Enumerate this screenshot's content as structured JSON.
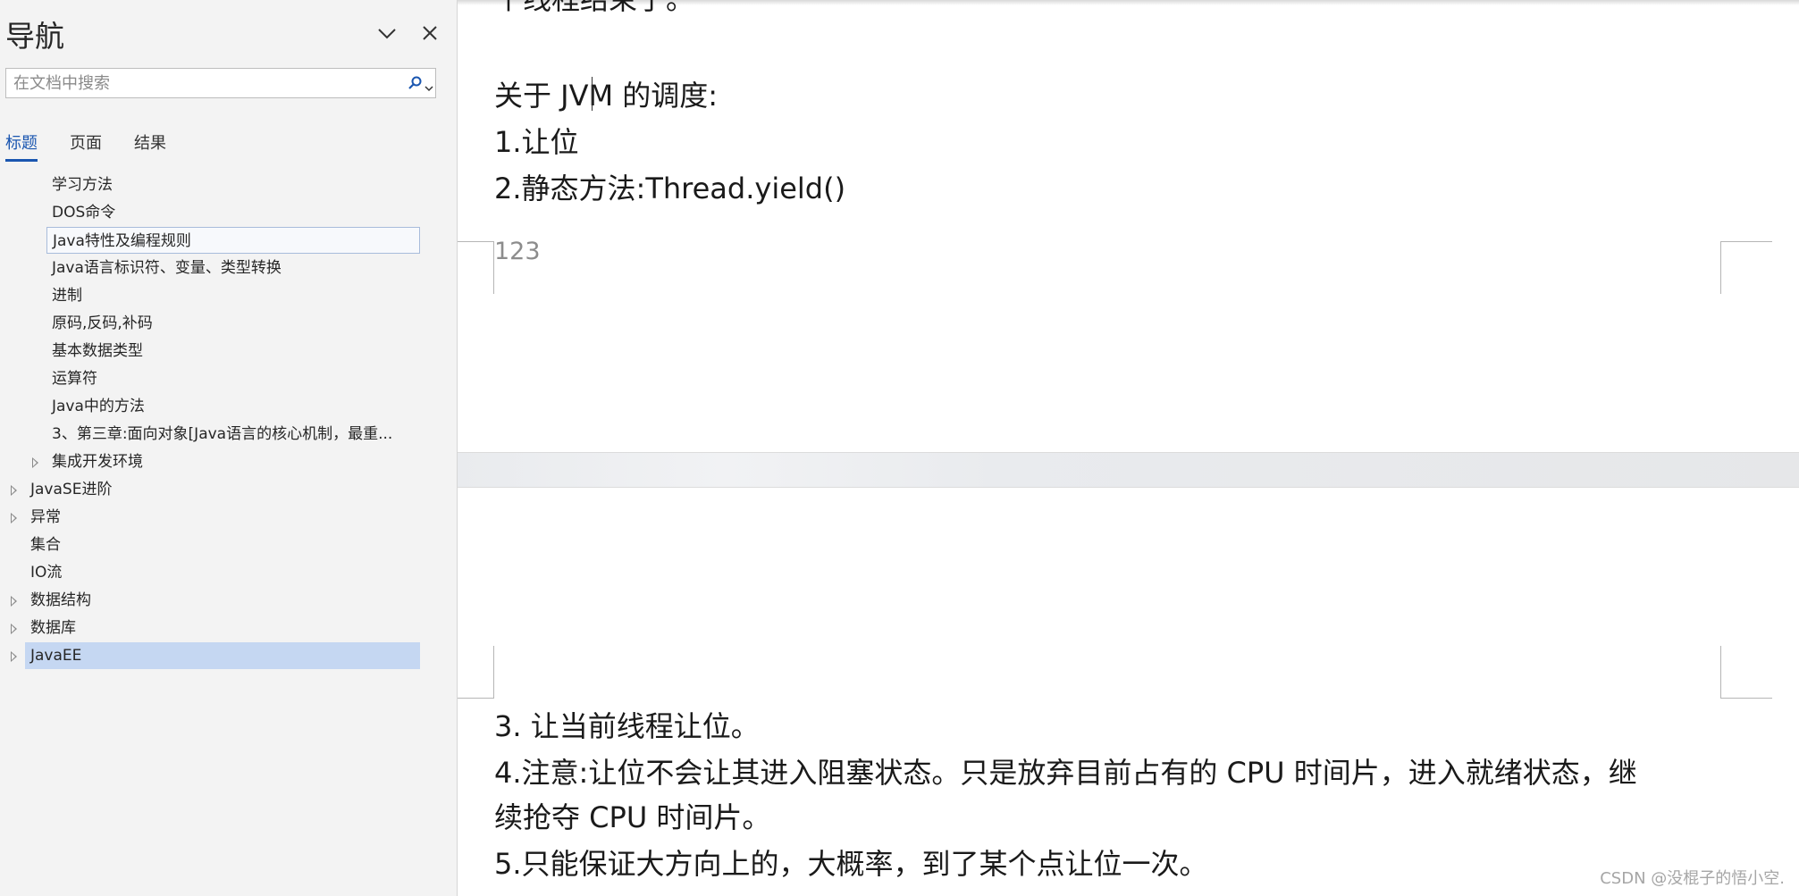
{
  "nav": {
    "title": "导航",
    "search_placeholder": "在文档中搜索",
    "tabs": [
      "标题",
      "页面",
      "结果"
    ],
    "headings": [
      {
        "label": "学习方法",
        "level": 3,
        "expandable": false,
        "state": "normal"
      },
      {
        "label": "DOS命令",
        "level": 3,
        "expandable": false,
        "state": "normal"
      },
      {
        "label": "Java特性及编程规则",
        "level": 3,
        "expandable": false,
        "state": "hover"
      },
      {
        "label": "Java语言标识符、变量、类型转换",
        "level": 3,
        "expandable": false,
        "state": "normal"
      },
      {
        "label": "进制",
        "level": 3,
        "expandable": false,
        "state": "normal"
      },
      {
        "label": "原码,反码,补码",
        "level": 3,
        "expandable": false,
        "state": "normal"
      },
      {
        "label": "基本数据类型",
        "level": 3,
        "expandable": false,
        "state": "normal"
      },
      {
        "label": "运算符",
        "level": 3,
        "expandable": false,
        "state": "normal"
      },
      {
        "label": "Java中的方法",
        "level": 3,
        "expandable": false,
        "state": "normal"
      },
      {
        "label": "3、第三章:面向对象[Java语言的核心机制，最重...",
        "level": 3,
        "expandable": false,
        "state": "normal"
      },
      {
        "label": "集成开发环境",
        "level": 3,
        "expandable": true,
        "state": "normal"
      },
      {
        "label": "JavaSE进阶",
        "level": 2,
        "expandable": true,
        "state": "normal"
      },
      {
        "label": "异常",
        "level": 2,
        "expandable": true,
        "state": "normal"
      },
      {
        "label": "集合",
        "level": 2,
        "expandable": false,
        "state": "normal"
      },
      {
        "label": "IO流",
        "level": 2,
        "expandable": false,
        "state": "normal"
      },
      {
        "label": "数据结构",
        "level": 2,
        "expandable": true,
        "state": "normal"
      },
      {
        "label": "数据库",
        "level": 2,
        "expandable": true,
        "state": "normal"
      },
      {
        "label": "JavaEE",
        "level": 2,
        "expandable": true,
        "state": "selected"
      }
    ]
  },
  "doc": {
    "page1_lines": [
      "个线程结束了。",
      "",
      "关于 JVM 的调度:",
      "1.让位",
      "2.静态方法:Thread.yield()"
    ],
    "footer": "123",
    "page2_lines": [
      "3.  让当前线程让位。",
      "4.注意:让位不会让其进入阻塞状态。只是放弃目前占有的 CPU 时间片，进入就绪状态，继",
      "续抢夺 CPU 时间片。",
      "5.只能保证大方向上的，大概率，到了某个点让位一次。"
    ]
  },
  "watermark": "CSDN @没棍子的悟小空."
}
